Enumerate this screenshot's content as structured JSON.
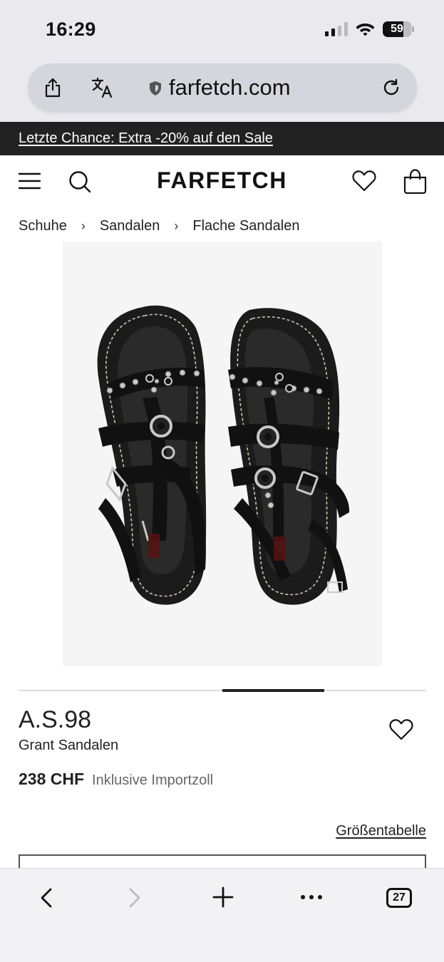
{
  "status_bar": {
    "time": "16:29",
    "battery": "59"
  },
  "url_bar": {
    "domain": "farfetch.com"
  },
  "promo_banner": {
    "text": "Letzte Chance: Extra -20% auf den Sale"
  },
  "header": {
    "logo": "FARFETCH"
  },
  "breadcrumb": {
    "items": [
      "Schuhe",
      "Sandalen",
      "Flache Sandalen"
    ],
    "separator": "›"
  },
  "carousel": {
    "active_index": 2,
    "total": 4
  },
  "product": {
    "brand": "A.S.98",
    "name": "Grant Sandalen",
    "price": "238 CHF",
    "price_note": "Inklusive Importzoll",
    "size_chart_label": "Größentabelle"
  },
  "toolbar": {
    "tab_count": "27"
  },
  "colors": {
    "promo_bg": "#222222",
    "browser_chrome": "#e9e9ee",
    "url_bar": "#d5d6dd",
    "image_bg": "#f5f5f5",
    "text": "#222222"
  },
  "icons": [
    "share-icon",
    "translate-icon",
    "shield-icon",
    "reload-icon",
    "menu-icon",
    "search-icon",
    "heart-icon",
    "bag-icon",
    "back-icon",
    "forward-icon",
    "plus-icon",
    "more-icon",
    "tabs-icon"
  ]
}
